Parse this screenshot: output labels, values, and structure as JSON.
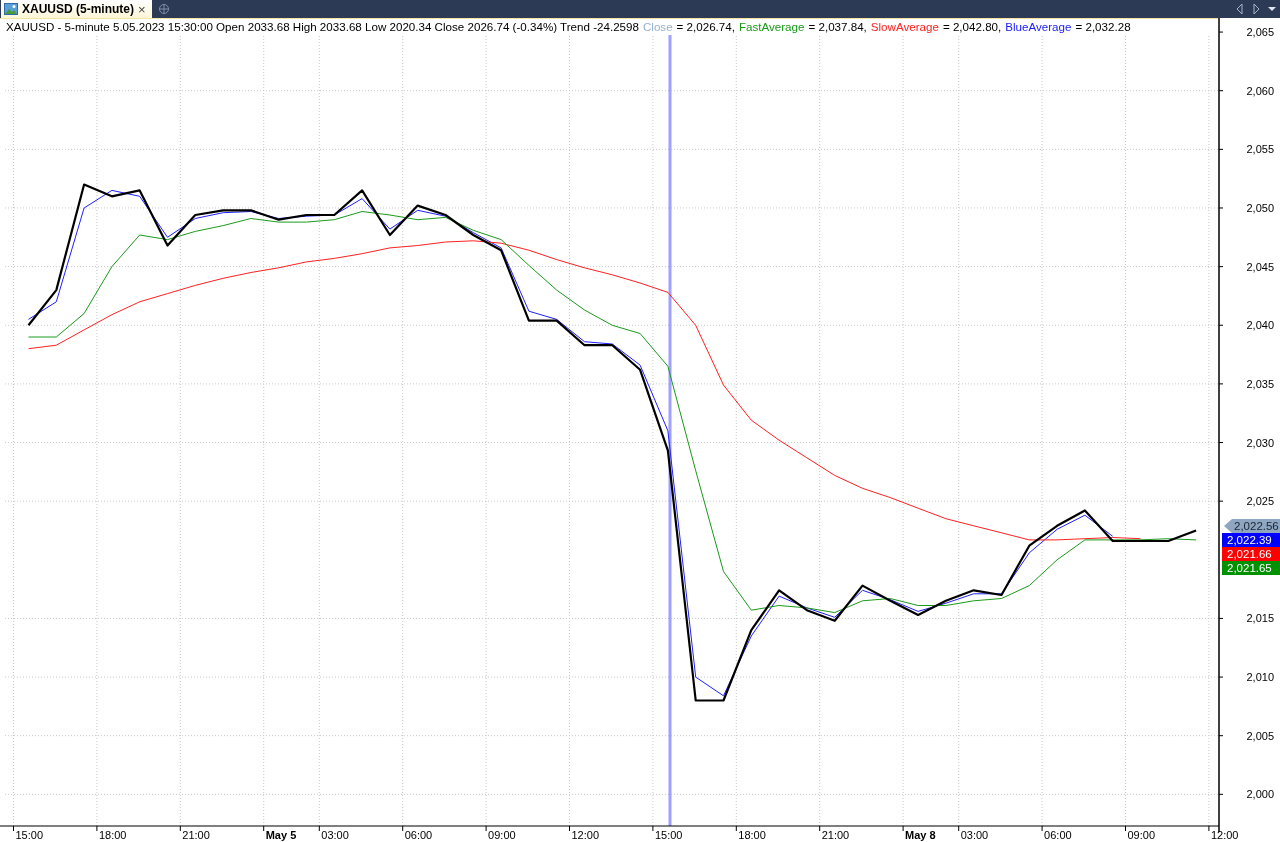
{
  "tabs": [
    {
      "label": "XAUUSD (5-minute)",
      "close": "×",
      "selected": true
    }
  ],
  "legend": {
    "summary": "XAUUSD - 5-minute 5.05.2023 15:30:00 Open 2033.68 High 2033.68 Low 2020.34 Close 2026.74 (-0.34%) Trend -24.2598",
    "items": [
      {
        "value": "= 2,026.74,",
        "color": "#99b0cc"
      },
      {
        "value": "= 2,037.84,",
        "color": "#1a9a1a"
      },
      {
        "value": "= 2,042.80,",
        "color": "#ff2020"
      },
      {
        "value": "= 2,032.28",
        "color": "#2020ff"
      }
    ]
  },
  "price_tags": [
    {
      "text": "2,022.56",
      "color": "#8ea6c2",
      "kind": "arrow"
    },
    {
      "text": "2,022.39",
      "color": "#0000ff",
      "kind": "box"
    },
    {
      "text": "2,021.66",
      "color": "#ff0000",
      "kind": "box"
    },
    {
      "text": "2,021.65",
      "color": "#009000",
      "kind": "box"
    }
  ],
  "chart_data": {
    "type": "line",
    "categories": [
      "15:00",
      null,
      null,
      "18:00",
      null,
      null,
      "21:00",
      null,
      null,
      "May 5",
      null,
      "03:00",
      null,
      null,
      "06:00",
      null,
      null,
      "09:00",
      null,
      null,
      "12:00",
      null,
      null,
      "15:00",
      null,
      null,
      "18:00",
      null,
      null,
      "21:00",
      null,
      null,
      "May 8",
      null,
      "03:00",
      null,
      null,
      "06:00",
      null,
      null,
      "09:00",
      null,
      null,
      "12:00"
    ],
    "ylim": [
      1997.3,
      2066.2
    ],
    "yticks": [
      {
        "value": 2000,
        "label": "2,000"
      },
      {
        "value": 2005,
        "label": "2,005"
      },
      {
        "value": 2010,
        "label": "2,010"
      },
      {
        "value": 2015,
        "label": "2,015"
      },
      {
        "value": 2025,
        "label": "2,025"
      },
      {
        "value": 2030,
        "label": "2,030"
      },
      {
        "value": 2035,
        "label": "2,035"
      },
      {
        "value": 2040,
        "label": "2,040"
      },
      {
        "value": 2045,
        "label": "2,045"
      },
      {
        "value": 2050,
        "label": "2,050"
      },
      {
        "value": 2055,
        "label": "2,055"
      },
      {
        "value": 2060,
        "label": "2,060"
      },
      {
        "value": 2065,
        "label": "2,065"
      }
    ],
    "series": [
      {
        "name": "Close",
        "color": "#000000",
        "values": [
          2040,
          2043,
          2052,
          2051,
          2051.5,
          2046.8,
          2049.4,
          2049.8,
          2049.8,
          2049,
          2049.4,
          2049.4,
          2051.5,
          2047.7,
          2050.2,
          2049.4,
          2047.7,
          2046.4,
          2040.4,
          2040.4,
          2038.3,
          2038.3,
          2036.2,
          2029.3,
          2008,
          2008,
          2014,
          2017.4,
          2015.7,
          2014.8,
          2017.8,
          2016.5,
          2015.3,
          2016.5,
          2017.4,
          2017,
          2021.2,
          2022.9,
          2024.2,
          2021.6,
          2021.6,
          2021.6,
          2022.5,
          null
        ]
      },
      {
        "name": "FastAverage",
        "color": "#1a9a1a",
        "values": [
          2039,
          2039,
          2041,
          2045,
          2047.7,
          2047.3,
          2048,
          2048.5,
          2049.1,
          2048.8,
          2048.8,
          2049,
          2049.7,
          2049.4,
          2049,
          2049.2,
          2048.1,
          2047.3,
          2045.1,
          2043,
          2041.3,
          2040,
          2039.3,
          2036.5,
          2027.6,
          2019,
          2015.7,
          2016.1,
          2015.9,
          2015.5,
          2016.5,
          2016.7,
          2016.1,
          2016.1,
          2016.5,
          2016.7,
          2017.8,
          2020,
          2021.7,
          2021.7,
          2021.7,
          2021.8,
          2021.7,
          null
        ]
      },
      {
        "name": "SlowAverage",
        "color": "#ff2020",
        "values": [
          2038,
          2038.3,
          2039.6,
          2040.9,
          2042,
          2042.7,
          2043.4,
          2044,
          2044.5,
          2044.9,
          2045.4,
          2045.7,
          2046.1,
          2046.6,
          2046.8,
          2047.1,
          2047.2,
          2047,
          2046.4,
          2045.6,
          2044.9,
          2044.3,
          2043.6,
          2042.8,
          2040,
          2034.9,
          2031.9,
          2030.2,
          2028.7,
          2027.2,
          2026.1,
          2025.3,
          2024.4,
          2023.5,
          2022.9,
          2022.3,
          2021.7,
          2021.7,
          2021.8,
          2021.9,
          2021.8,
          null,
          null,
          null
        ]
      },
      {
        "name": "BlueAverage",
        "color": "#2020ff",
        "values": [
          2040.5,
          2042,
          2050,
          2051.5,
          2051,
          2047.5,
          2049.1,
          2049.6,
          2049.7,
          2049.1,
          2049.3,
          2049.4,
          2050.8,
          2048.2,
          2049.8,
          2049.3,
          2047.9,
          2046.6,
          2041.2,
          2040.5,
          2038.6,
          2038.4,
          2036.6,
          2031,
          2010,
          2008.4,
          2013.5,
          2016.9,
          2015.9,
          2015.1,
          2017.4,
          2016.6,
          2015.6,
          2016.3,
          2017.1,
          2017.1,
          2020.6,
          2022.6,
          2023.8,
          2022,
          null,
          null,
          null,
          null
        ]
      }
    ],
    "grid": true
  }
}
